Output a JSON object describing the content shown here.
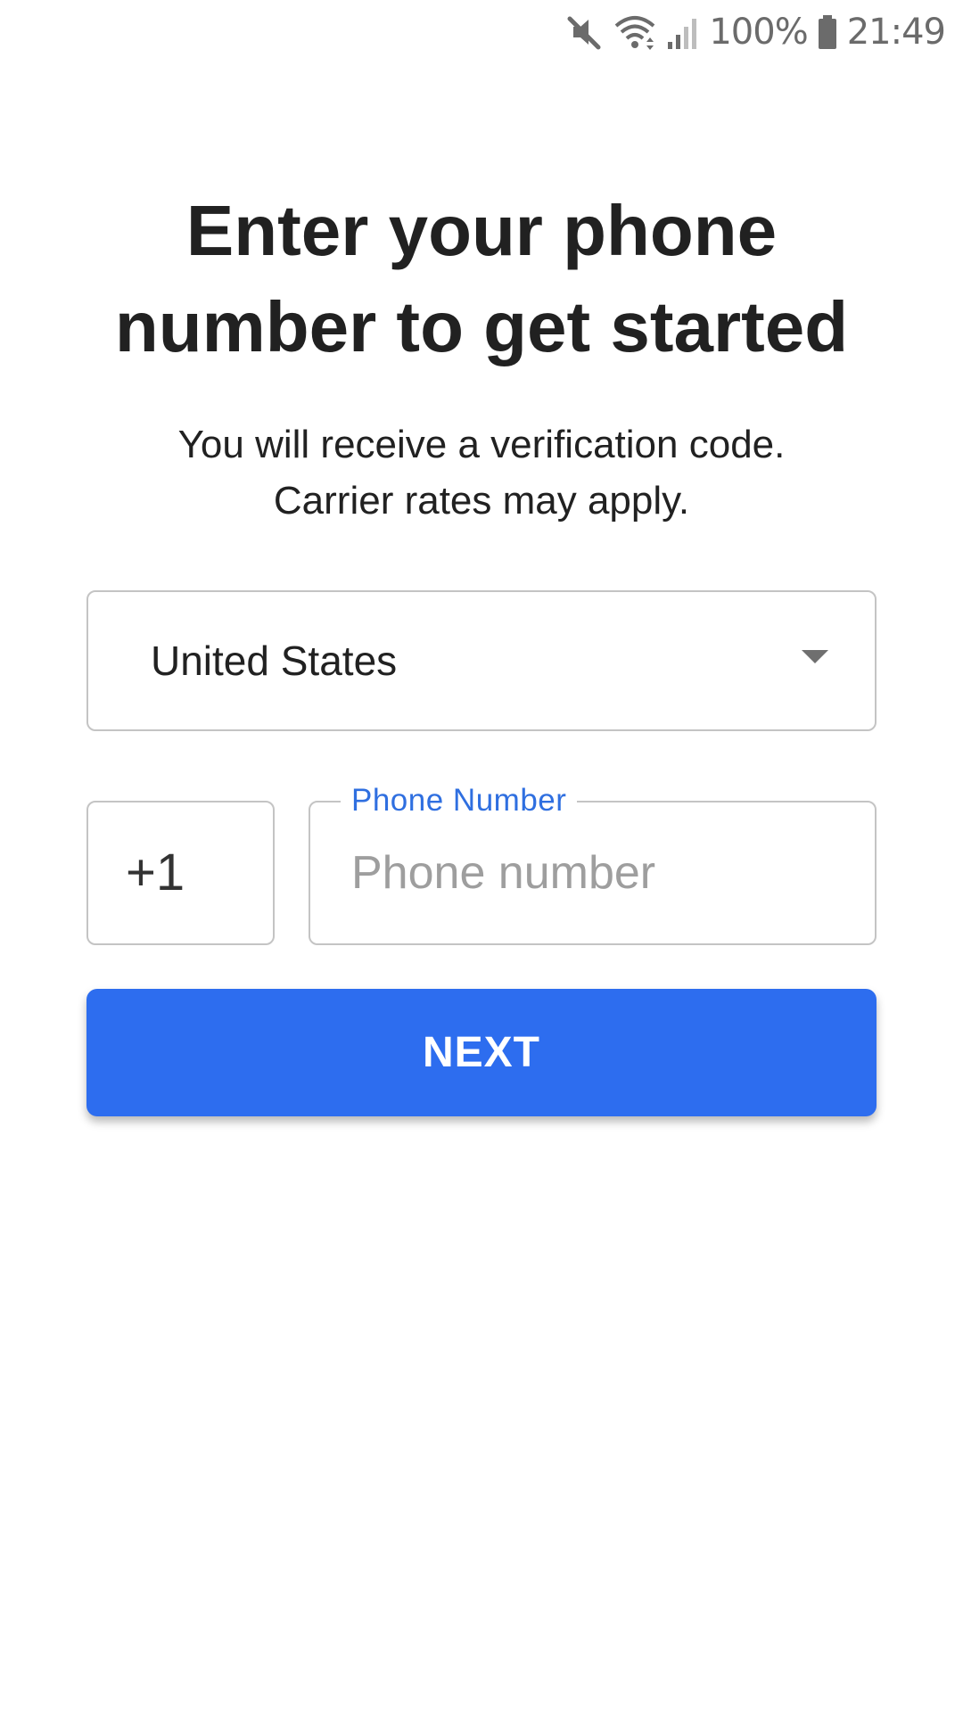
{
  "status_bar": {
    "icons": [
      "mute-icon",
      "wifi-icon",
      "signal-icon",
      "battery-icon"
    ],
    "battery_text": "100%",
    "time": "21:49"
  },
  "header": {
    "title": "Enter your phone number to get started",
    "subtitle_line1": "You will receive a verification code.",
    "subtitle_line2": "Carrier rates may apply."
  },
  "form": {
    "country": {
      "selected": "United States",
      "dropdown_icon": "caret-down-icon"
    },
    "dial_code": "+1",
    "phone": {
      "label": "Phone Number",
      "placeholder": "Phone number",
      "value": ""
    },
    "next_label": "NEXT"
  },
  "colors": {
    "accent": "#2D6DEF",
    "label_accent": "#2F6FE0",
    "text_primary": "#212121",
    "placeholder": "#9E9E9E",
    "border": "#C4C4C4",
    "status_icons": "#6B6B6B"
  }
}
